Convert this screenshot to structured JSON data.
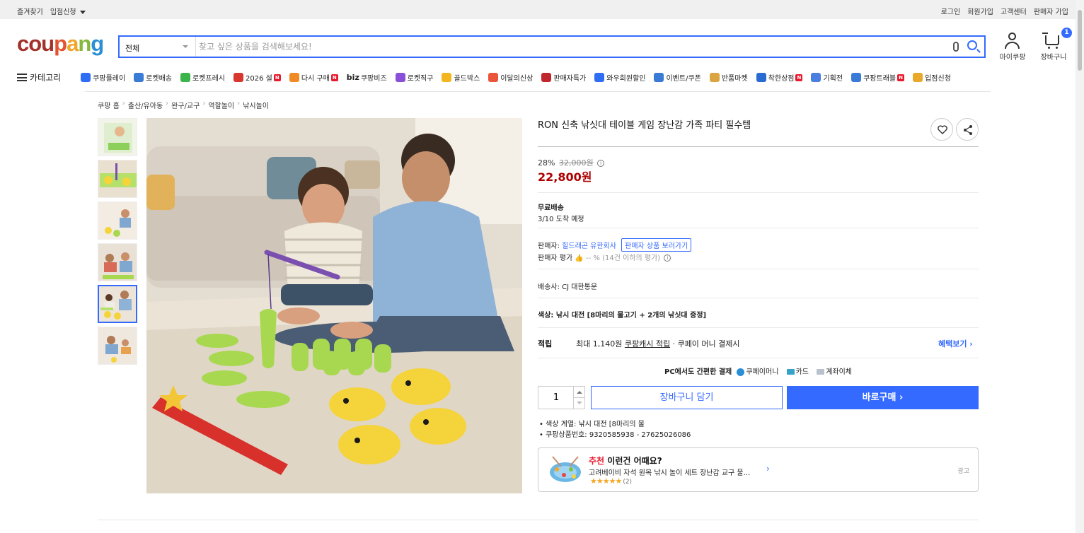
{
  "topbar": {
    "left": [
      "즐겨찾기",
      "입점신청"
    ],
    "right": [
      "로그인",
      "회원가입",
      "고객센터",
      "판매자 가입"
    ]
  },
  "logo": [
    "cou",
    "p",
    "a",
    "n",
    "g"
  ],
  "search": {
    "category": "전체",
    "placeholder": "찾고 싶은 상품을 검색해보세요!"
  },
  "header": {
    "mypage": "마이쿠팡",
    "cart": "장바구니",
    "cart_count": "1"
  },
  "nav": {
    "category": "카테고리",
    "items": [
      {
        "label": "쿠팡플레이",
        "color": "#2f6df5",
        "new": false
      },
      {
        "label": "로켓배송",
        "color": "#3a7bd5",
        "new": false
      },
      {
        "label": "로켓프레시",
        "color": "#3bb54a",
        "new": false
      },
      {
        "label": "2026 설",
        "color": "#d7372f",
        "new": true
      },
      {
        "label": "다시 구매",
        "color": "#f08a24",
        "new": true
      },
      {
        "label": "쿠팡비즈",
        "color": "#333333",
        "new": false
      },
      {
        "label": "로켓직구",
        "color": "#8a4fd8",
        "new": false
      },
      {
        "label": "골드박스",
        "color": "#f3b61f",
        "new": false
      },
      {
        "label": "이달의신상",
        "color": "#e9543b",
        "new": false
      },
      {
        "label": "판매자특가",
        "color": "#c0272d",
        "new": false
      },
      {
        "label": "와우회원할인",
        "color": "#2f6df5",
        "new": false
      },
      {
        "label": "이벤트/쿠폰",
        "color": "#3a7bd5",
        "new": false
      },
      {
        "label": "반품마켓",
        "color": "#d9a441",
        "new": false
      },
      {
        "label": "착한상점",
        "color": "#2a6bd1",
        "new": true
      },
      {
        "label": "기획전",
        "color": "#4a7ee0",
        "new": false
      },
      {
        "label": "쿠팡트래블",
        "color": "#3a7bd5",
        "new": true
      },
      {
        "label": "입점신청",
        "color": "#e8a92a",
        "new": false
      }
    ],
    "new_badge": "N",
    "biz": "biz"
  },
  "breadcrumb": [
    "쿠팡 홈",
    "출산/유아동",
    "완구/교구",
    "역할놀이",
    "낚시놀이"
  ],
  "product": {
    "title": "RON 신축 낚싯대 테이블 게임 장난감 가족 파티 필수템",
    "discount": "28%",
    "original_price": "32,000원",
    "price": "22,800원",
    "shipping_title": "무료배송",
    "arrival": "3/10 도착 예정",
    "seller_label": "판매자:",
    "seller_name": "힐드래곤 유한회사",
    "seller_button": "판매자 상품 보러가기",
    "seller_rating_label": "판매자 평가",
    "seller_rating_value": "👍 -- % (14건 이하의 평가)",
    "carrier": "배송사: CJ 대한통운",
    "color_option": "색상: 낚시 대전 [8마리의 물고기 + 2개의 낚싯대 증정]",
    "points_label": "적립",
    "points_prefix": "최대 1,140원",
    "points_link": "쿠팡캐시 적립",
    "points_suffix": "· 쿠페이 머니 결제시",
    "benefit": "혜택보기 ›",
    "pay_label": "PC에서도 간편한 결제",
    "pay_options": [
      "쿠페이머니",
      "카드",
      "계좌이체"
    ],
    "quantity": "1",
    "cart_button": "장바구니 담기",
    "buy_button": "바로구매 ›",
    "details": [
      "색상 계열: 낚시 대전 [8마리의 물",
      "쿠팡상품번호: 9320585938 - 27625026086"
    ]
  },
  "recommend": {
    "head_red": "추천",
    "head": "이런건 어때요?",
    "name": "고려베이비 자석 원목 낚시 놀이 세트 장난감 교구 물...",
    "stars": "★★★★★",
    "count": "(2)",
    "ad": "광고",
    "chevron": "›"
  },
  "colors": {
    "accent": "#346aff",
    "price": "#ae0000"
  }
}
